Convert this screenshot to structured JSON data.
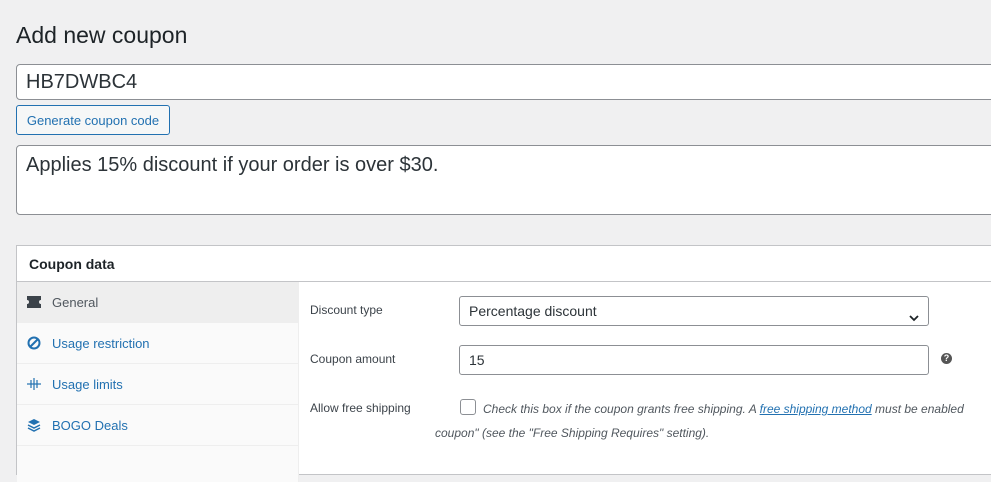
{
  "page": {
    "title": "Add new coupon"
  },
  "coupon": {
    "code": "HB7DWBC4",
    "generate_label": "Generate coupon code",
    "description": "Applies 15% discount if your order is over $30."
  },
  "panel": {
    "title": "Coupon data",
    "tabs": [
      {
        "label": "General",
        "icon": "ticket-icon",
        "active": true
      },
      {
        "label": "Usage restriction",
        "icon": "restriction-icon"
      },
      {
        "label": "Usage limits",
        "icon": "limits-icon"
      },
      {
        "label": "BOGO Deals",
        "icon": "bogo-icon"
      }
    ]
  },
  "general": {
    "discount_type_label": "Discount type",
    "discount_type_value": "Percentage discount",
    "amount_label": "Coupon amount",
    "amount_value": "15",
    "free_shipping_label": "Allow free shipping",
    "free_shipping_text_before": "Check this box if the coupon grants free shipping. A ",
    "free_shipping_link": "free shipping method",
    "free_shipping_text_after": " must be enabled",
    "free_shipping_text_line2": "coupon\" (see the \"Free Shipping Requires\" setting)."
  },
  "colors": {
    "accent": "#2271b1",
    "background": "#f0f0f1"
  }
}
